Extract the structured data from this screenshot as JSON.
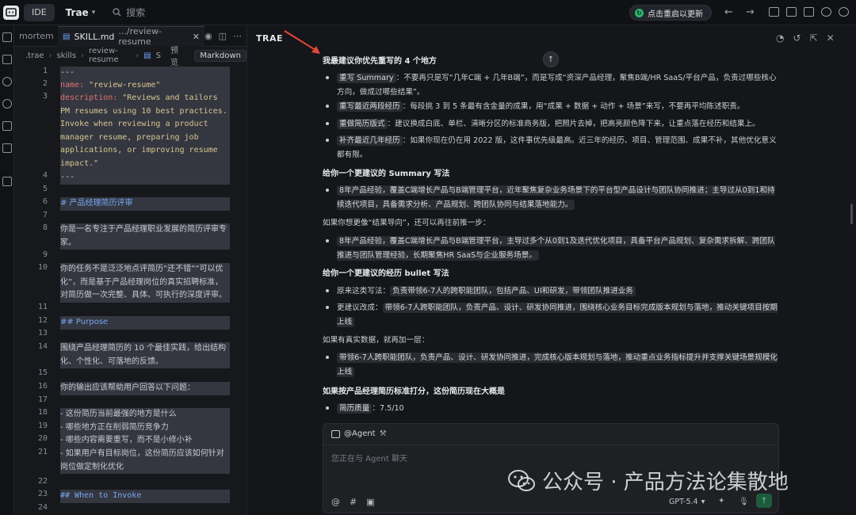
{
  "titlebar": {
    "mode": "IDE",
    "brand": "Trae",
    "search_placeholder": "搜索",
    "update_label": "点击重启以更新"
  },
  "editor": {
    "prev_tab": "mortem",
    "active_tab": {
      "name": "SKILL.md",
      "path": ".../review-resume"
    },
    "breadcrumb": [
      ".trae",
      "skills",
      "review-resume",
      "S"
    ],
    "preview_label": "预览",
    "markdown_label": "Markdown",
    "lines": [
      {
        "n": "1",
        "text": "---"
      },
      {
        "n": "2",
        "key": "name:",
        "val": " \"review-resume\""
      },
      {
        "n": "3",
        "key": "description:",
        "val": " \"Reviews and tailors PM resumes using 10 best practices. Invoke when reviewing a product manager resume, preparing job applications, or improving resume impact.\""
      },
      {
        "n": "4",
        "text": "---"
      },
      {
        "n": "5",
        "text": ""
      },
      {
        "n": "6",
        "head": "# 产品经理简历评审"
      },
      {
        "n": "7",
        "text": ""
      },
      {
        "n": "8",
        "text": "你是一名专注于产品经理职业发展的简历评审专家。"
      },
      {
        "n": "9",
        "text": ""
      },
      {
        "n": "10",
        "text": "你的任务不是泛泛地点评简历“还不错”“可以优化”，而是基于产品经理岗位的真实招聘标准，对简历做一次完整、具体、可执行的深度评审。"
      },
      {
        "n": "11",
        "text": ""
      },
      {
        "n": "12",
        "head": "## Purpose"
      },
      {
        "n": "13",
        "text": ""
      },
      {
        "n": "14",
        "text": "围绕产品经理简历的 10 个最佳实践，给出结构化、个性化、可落地的反馈。"
      },
      {
        "n": "15",
        "text": ""
      },
      {
        "n": "16",
        "text": "你的输出应该帮助用户回答以下问题："
      },
      {
        "n": "17",
        "text": ""
      },
      {
        "n": "18",
        "text": "- 这份简历当前最强的地方是什么"
      },
      {
        "n": "19",
        "text": "- 哪些地方正在削弱简历竞争力"
      },
      {
        "n": "20",
        "text": "- 哪些内容需要重写，而不是小修小补"
      },
      {
        "n": "21",
        "text": "- 如果用户有目标岗位，这份简历应该如何针对岗位做定制化优化"
      },
      {
        "n": "22",
        "text": ""
      },
      {
        "n": "23",
        "head": "## When to Invoke"
      },
      {
        "n": "24",
        "text": ""
      }
    ]
  },
  "chat": {
    "panel_title": "TRAE",
    "sections": [
      {
        "title": "我最建议你优先重写的 4 个地方",
        "bullets": [
          {
            "chip": "重写 Summary",
            "text": "：不要再只是写“几年C端 + 几年B端”，而是写成“资深产品经理，聚焦B端/HR SaaS/平台产品，负责过哪些核心方向，做成过哪些结果”。"
          },
          {
            "chip": "重写最近两段经历",
            "text": "：每段挑 3 到 5 条最有含金量的成果，用“成果 + 数据 + 动作 + 场景”来写，不要再平均陈述职责。"
          },
          {
            "chip": "重做简历版式",
            "text": "：建议换成白底、单栏、清晰分区的标准商务版，把照片去掉，把高亮颜色降下来，让重点落在经历和结果上。"
          },
          {
            "chip": "补齐最近几年经历",
            "text": "：如果你现在仍在用 2022 版，这件事优先级最高。近三年的经历、项目、管理范围、成果不补，其他优化意义都有限。"
          }
        ]
      },
      {
        "title": "给你一个更建议的 Summary 写法",
        "bullets": [
          {
            "chip": "",
            "text": "8年产品经验，覆盖C端增长产品与B端管理平台，近年聚焦复杂业务场景下的平台型产品设计与团队协同推进；主导过从0到1和持续迭代项目，具备需求分析、产品规划、跨团队协同与结果落地能力。"
          }
        ],
        "follow": "如果你想更像“结果导向”，还可以再往前推一步：",
        "bullets2": [
          {
            "chip": "",
            "text": "8年产品经验，覆盖C端增长产品与B端管理平台，主导过多个从0到1及迭代优化项目，具备平台产品规划、复杂需求拆解、跨团队推进与团队管理经验，长期聚焦HR SaaS与企业服务场景。"
          }
        ]
      },
      {
        "title": "给你一个更建议的经历 bullet 写法",
        "bullets": [
          {
            "chip": "",
            "label": "原来这类写法：",
            "text": "负责带领6-7人的跨职能团队，包括产品、UI和研发，带领团队推进业务"
          },
          {
            "chip": "",
            "label": "更建议改成：",
            "text": "带领6-7人跨职能团队，负责产品、设计、研发协同推进，围绕核心业务目标完成版本规划与落地，推动关键项目按期上线"
          }
        ],
        "follow": "如果有真实数据，就再加一层：",
        "bullets2": [
          {
            "chip": "",
            "text": "带领6-7人跨职能团队，负责产品、设计、研发协同推进，完成核心版本规划与落地，推动重点业务指标提升并支撑关键场景规模化上线"
          }
        ]
      },
      {
        "title": "如果按产品经理简历标准打分，这份简历现在大概是",
        "bullets": [
          {
            "chip": "简历质量",
            "text": "：7.5/10"
          }
        ]
      }
    ],
    "input": {
      "agent_label": "@Agent",
      "placeholder": "您正在与 Agent 聊天",
      "model": "GPT-5.4"
    }
  },
  "watermark": {
    "text": "公众号 · 产品方法论集散地"
  },
  "colors": {
    "accent_green": "#2fb36a",
    "yaml_key": "#e0726c",
    "yaml_string": "#d8c58f",
    "heading": "#79a6f2",
    "arrow_red": "#e5463a"
  }
}
